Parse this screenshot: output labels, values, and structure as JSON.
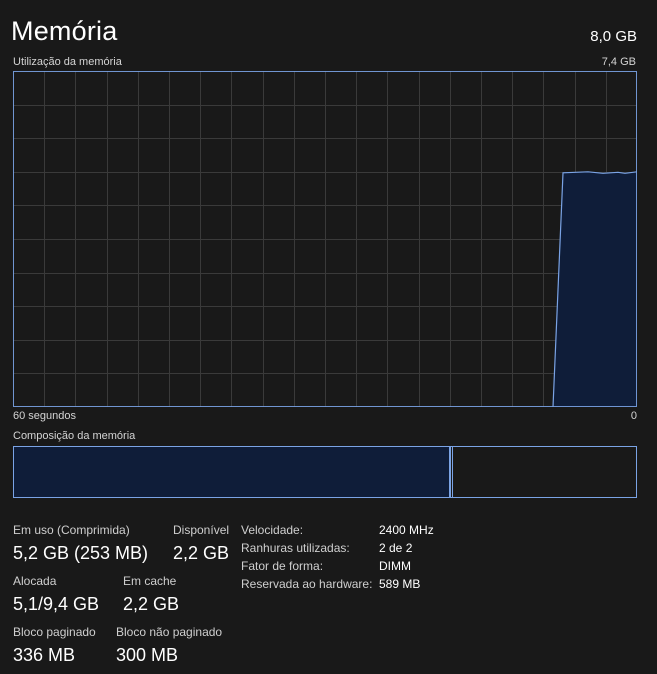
{
  "header": {
    "title": "Memória",
    "total": "8,0 GB"
  },
  "usage_graph": {
    "label": "Utilização da memória",
    "max_label": "7,4 GB",
    "left_time_label": "60 segundos",
    "right_time_label": "0",
    "line_color": "#7aa3e5",
    "fill_color": "#0f1d39",
    "grid_color": "#3a3a3a",
    "usage_fraction_recent": 0.7
  },
  "composition": {
    "label": "Composição da memória",
    "in_use_fraction": 0.698,
    "modified_fraction": 0.004
  },
  "stats": {
    "in_use": {
      "label": "Em uso (Comprimida)",
      "value": "5,2 GB (253 MB)"
    },
    "available": {
      "label": "Disponível",
      "value": "2,2 GB"
    },
    "committed": {
      "label": "Alocada",
      "value": "5,1/9,4 GB"
    },
    "cached": {
      "label": "Em cache",
      "value": "2,2 GB"
    },
    "paged_pool": {
      "label": "Bloco paginado",
      "value": "336 MB"
    },
    "nonpaged_pool": {
      "label": "Bloco não paginado",
      "value": "300 MB"
    }
  },
  "specs": {
    "speed": {
      "label": "Velocidade:",
      "value": "2400 MHz"
    },
    "slots": {
      "label": "Ranhuras utilizadas:",
      "value": "2 de 2"
    },
    "form_factor": {
      "label": "Fator de forma:",
      "value": "DIMM"
    },
    "reserved": {
      "label": "Reservada ao hardware:",
      "value": "589 MB"
    }
  }
}
